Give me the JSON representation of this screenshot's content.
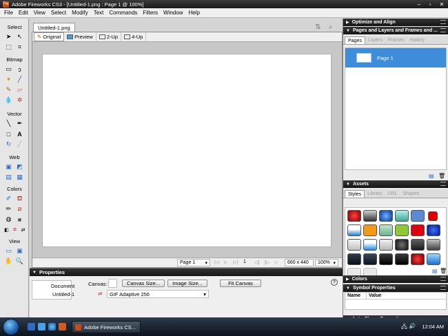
{
  "window": {
    "title": "Adobe Fireworks CS3 - [Untitled-1.png : Page 1 @ 100%]"
  },
  "menu": [
    "File",
    "Edit",
    "View",
    "Select",
    "Modify",
    "Text",
    "Commands",
    "Filters",
    "Window",
    "Help"
  ],
  "tools": {
    "sections": [
      "Select",
      "Bitmap",
      "Vector",
      "Web",
      "Colors",
      "View"
    ]
  },
  "document": {
    "tab": "Untitled-1.png",
    "views": [
      "Original",
      "Preview",
      "2-Up",
      "4-Up"
    ],
    "status": {
      "page": "Page 1",
      "frame": "1",
      "size": "660 x 440",
      "zoom": "100%"
    }
  },
  "properties": {
    "title": "Properties",
    "object_type": "Document",
    "object_name": "Untitled-1",
    "canvas_label": "Canvas:",
    "canvas_size_button": "Canvas Size...",
    "image_size_button": "Image Size...",
    "fit_canvas_button": "Fit Canvas",
    "export_format": "GIF Adaptive 256",
    "help": "?"
  },
  "panels": {
    "optimize": "Optimize and Align",
    "pages_group": "Pages and Layers and Frames and ...",
    "pages_tabs": [
      "Pages",
      "Layers",
      "Frames",
      "History"
    ],
    "page_item": "Page 1",
    "assets": "Assets",
    "assets_tabs": [
      "Styles",
      "Library",
      "URL",
      "Shapes"
    ],
    "colors": "Colors",
    "symbol_properties": "Symbol Properties",
    "symbol_cols": [
      "Name",
      "Value"
    ],
    "auto_shape": "Auto Shape Properties"
  },
  "taskbar": {
    "task": "Adobe Fireworks CS...",
    "clock": "12:04 AM"
  }
}
